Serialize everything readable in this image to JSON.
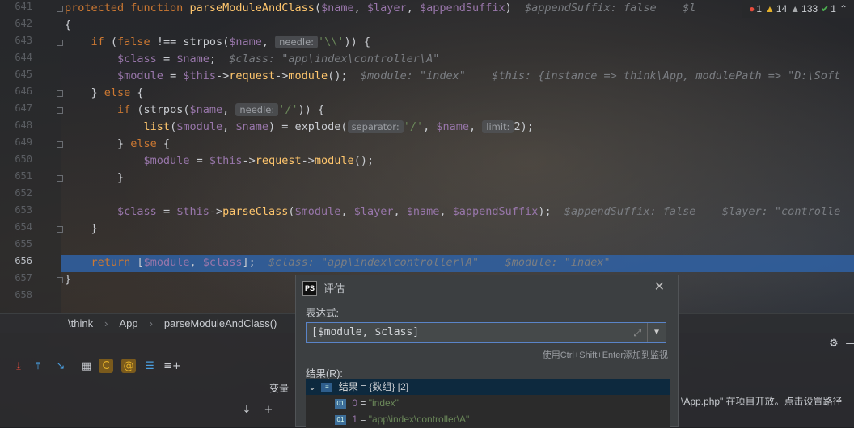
{
  "editor": {
    "line_numbers": [
      "641",
      "642",
      "643",
      "644",
      "645",
      "646",
      "647",
      "648",
      "649",
      "650",
      "651",
      "652",
      "653",
      "654",
      "655",
      "656",
      "657",
      "658"
    ],
    "active_line": "656",
    "status": {
      "errors": "1",
      "warnings": "14",
      "weak_warnings": "133",
      "typos": "1"
    },
    "lines": [
      {
        "parts": [
          [
            "kw",
            "protected function "
          ],
          [
            "fn",
            "parseModuleAndClass"
          ],
          [
            "",
            "("
          ],
          [
            "var",
            "$name"
          ],
          [
            "",
            ", "
          ],
          [
            "var",
            "$layer"
          ],
          [
            "",
            ", "
          ],
          [
            "var",
            "$appendSuffix"
          ],
          [
            "",
            ")  "
          ],
          [
            "cm",
            "$appendSuffix: false    $l"
          ]
        ]
      },
      {
        "parts": [
          [
            "",
            "{"
          ]
        ]
      },
      {
        "parts": [
          [
            "",
            "    "
          ],
          [
            "kw",
            "if"
          ],
          [
            "",
            " ("
          ],
          [
            "kw",
            "false"
          ],
          [
            "",
            " !== strpos("
          ],
          [
            "var",
            "$name"
          ],
          [
            "",
            ", "
          ],
          [
            "hint",
            "needle:"
          ],
          [
            "str",
            "'\\\\'"
          ],
          [
            "",
            ")) {"
          ]
        ]
      },
      {
        "parts": [
          [
            "",
            "        "
          ],
          [
            "var",
            "$class"
          ],
          [
            "",
            " = "
          ],
          [
            "var",
            "$name"
          ],
          [
            "",
            ";  "
          ],
          [
            "cm",
            "$class: \"app\\index\\controller\\A\""
          ]
        ]
      },
      {
        "parts": [
          [
            "",
            "        "
          ],
          [
            "var",
            "$module"
          ],
          [
            "",
            " = "
          ],
          [
            "var",
            "$this"
          ],
          [
            "",
            "->"
          ],
          [
            "fn",
            "request"
          ],
          [
            "",
            "->"
          ],
          [
            "fn",
            "module"
          ],
          [
            "",
            "();  "
          ],
          [
            "cm",
            "$module: \"index\"    $this: {instance => think\\App, modulePath => \"D:\\Soft"
          ]
        ]
      },
      {
        "parts": [
          [
            "",
            "    } "
          ],
          [
            "kw",
            "else"
          ],
          [
            "",
            " {"
          ]
        ]
      },
      {
        "parts": [
          [
            "",
            "        "
          ],
          [
            "kw",
            "if"
          ],
          [
            "",
            " (strpos("
          ],
          [
            "var",
            "$name"
          ],
          [
            "",
            ", "
          ],
          [
            "hint",
            "needle:"
          ],
          [
            "str",
            "'/'"
          ],
          [
            "",
            ")) {"
          ]
        ]
      },
      {
        "parts": [
          [
            "",
            "            "
          ],
          [
            "fn",
            "list"
          ],
          [
            "",
            "("
          ],
          [
            "var",
            "$module"
          ],
          [
            "",
            ", "
          ],
          [
            "var",
            "$name"
          ],
          [
            "",
            ") = explode("
          ],
          [
            "hint",
            "separator:"
          ],
          [
            "str",
            "'/'"
          ],
          [
            "",
            ", "
          ],
          [
            "var",
            "$name"
          ],
          [
            "",
            ", "
          ],
          [
            "hint",
            "limit:"
          ],
          [
            "",
            "2);"
          ]
        ]
      },
      {
        "parts": [
          [
            "",
            "        } "
          ],
          [
            "kw",
            "else"
          ],
          [
            "",
            " {"
          ]
        ]
      },
      {
        "parts": [
          [
            "",
            "            "
          ],
          [
            "var",
            "$module"
          ],
          [
            "",
            " = "
          ],
          [
            "var",
            "$this"
          ],
          [
            "",
            "->"
          ],
          [
            "fn",
            "request"
          ],
          [
            "",
            "->"
          ],
          [
            "fn",
            "module"
          ],
          [
            "",
            "();"
          ]
        ]
      },
      {
        "parts": [
          [
            "",
            "        }"
          ]
        ]
      },
      {
        "parts": [
          [
            "",
            ""
          ]
        ]
      },
      {
        "parts": [
          [
            "",
            "        "
          ],
          [
            "var",
            "$class"
          ],
          [
            "",
            " = "
          ],
          [
            "var",
            "$this"
          ],
          [
            "",
            "->"
          ],
          [
            "fn",
            "parseClass"
          ],
          [
            "",
            "("
          ],
          [
            "var",
            "$module"
          ],
          [
            "",
            ", "
          ],
          [
            "var",
            "$layer"
          ],
          [
            "",
            ", "
          ],
          [
            "var",
            "$name"
          ],
          [
            "",
            ", "
          ],
          [
            "var",
            "$appendSuffix"
          ],
          [
            "",
            ");  "
          ],
          [
            "cm",
            "$appendSuffix: false    $layer: \"controlle"
          ]
        ]
      },
      {
        "parts": [
          [
            "",
            "    }"
          ]
        ]
      },
      {
        "parts": [
          [
            "",
            ""
          ]
        ]
      },
      {
        "parts": [
          [
            "",
            "    "
          ],
          [
            "kw",
            "return"
          ],
          [
            "",
            " ["
          ],
          [
            "var",
            "$module"
          ],
          [
            "",
            ", "
          ],
          [
            "var",
            "$class"
          ],
          [
            "",
            "];  "
          ],
          [
            "cm",
            "$class: \"app\\index\\controller\\A\"    $module: \"index\""
          ]
        ]
      },
      {
        "parts": [
          [
            "",
            "}"
          ]
        ]
      },
      {
        "parts": [
          [
            "",
            ""
          ]
        ]
      }
    ]
  },
  "breadcrumb": [
    "\\think",
    "App",
    "parseModuleAndClass()"
  ],
  "debugger": {
    "variables_tab": "变量",
    "right_text": "\\App.php\" 在项目开放。点击设置路径",
    "right_link": ""
  },
  "dialog": {
    "title": "评估",
    "expr_label": "表达式:",
    "expression": "[$module, $class]",
    "hint": "使用Ctrl+Shift+Enter添加到监视",
    "result_label": "结果(R):",
    "result_root": {
      "name": "结果",
      "value": "= {数组} [2]"
    },
    "items": [
      {
        "idx": "0",
        "value": "\"index\""
      },
      {
        "idx": "1",
        "value": "\"app\\index\\controller\\A\""
      }
    ]
  }
}
